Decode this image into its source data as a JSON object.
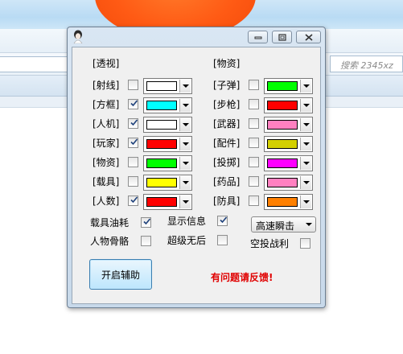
{
  "browser": {
    "search_placeholder": "搜索 2345xz"
  },
  "dialog": {
    "left_section_title": "[透视]",
    "right_section_title": "[物资]",
    "left_rows": [
      {
        "label": "[射线]",
        "checked": false,
        "color": "#ffffff"
      },
      {
        "label": "[方框]",
        "checked": true,
        "color": "#00ffff"
      },
      {
        "label": "[人机]",
        "checked": true,
        "color": "#ffffff"
      },
      {
        "label": "[玩家]",
        "checked": true,
        "color": "#ff0000"
      },
      {
        "label": "[物资]",
        "checked": false,
        "color": "#00ff00"
      },
      {
        "label": "[载具]",
        "checked": false,
        "color": "#ffff00"
      },
      {
        "label": "[人数]",
        "checked": true,
        "color": "#ff0000"
      }
    ],
    "right_rows": [
      {
        "label": "[子弹]",
        "checked": false,
        "color": "#00ff00"
      },
      {
        "label": "[步枪]",
        "checked": false,
        "color": "#ff0000"
      },
      {
        "label": "[武器]",
        "checked": false,
        "color": "#ff80c0"
      },
      {
        "label": "[配件]",
        "checked": false,
        "color": "#d4d000"
      },
      {
        "label": "[投掷]",
        "checked": false,
        "color": "#ff00ff"
      },
      {
        "label": "[药品]",
        "checked": false,
        "color": "#ff80c0"
      },
      {
        "label": "[防具]",
        "checked": false,
        "color": "#ff8000"
      }
    ],
    "options": {
      "vehicle_fuel": {
        "label": "载具油耗",
        "checked": true
      },
      "skeleton": {
        "label": "人物骨骼",
        "checked": false
      },
      "show_info": {
        "label": "显示信息",
        "checked": true
      },
      "no_recoil": {
        "label": "超级无后",
        "checked": false
      },
      "airdrop": {
        "label": "空投战利",
        "checked": false
      }
    },
    "mode_select_value": "高速瞬击",
    "start_button": "开启辅助",
    "feedback_text": "有问题请反馈!"
  }
}
